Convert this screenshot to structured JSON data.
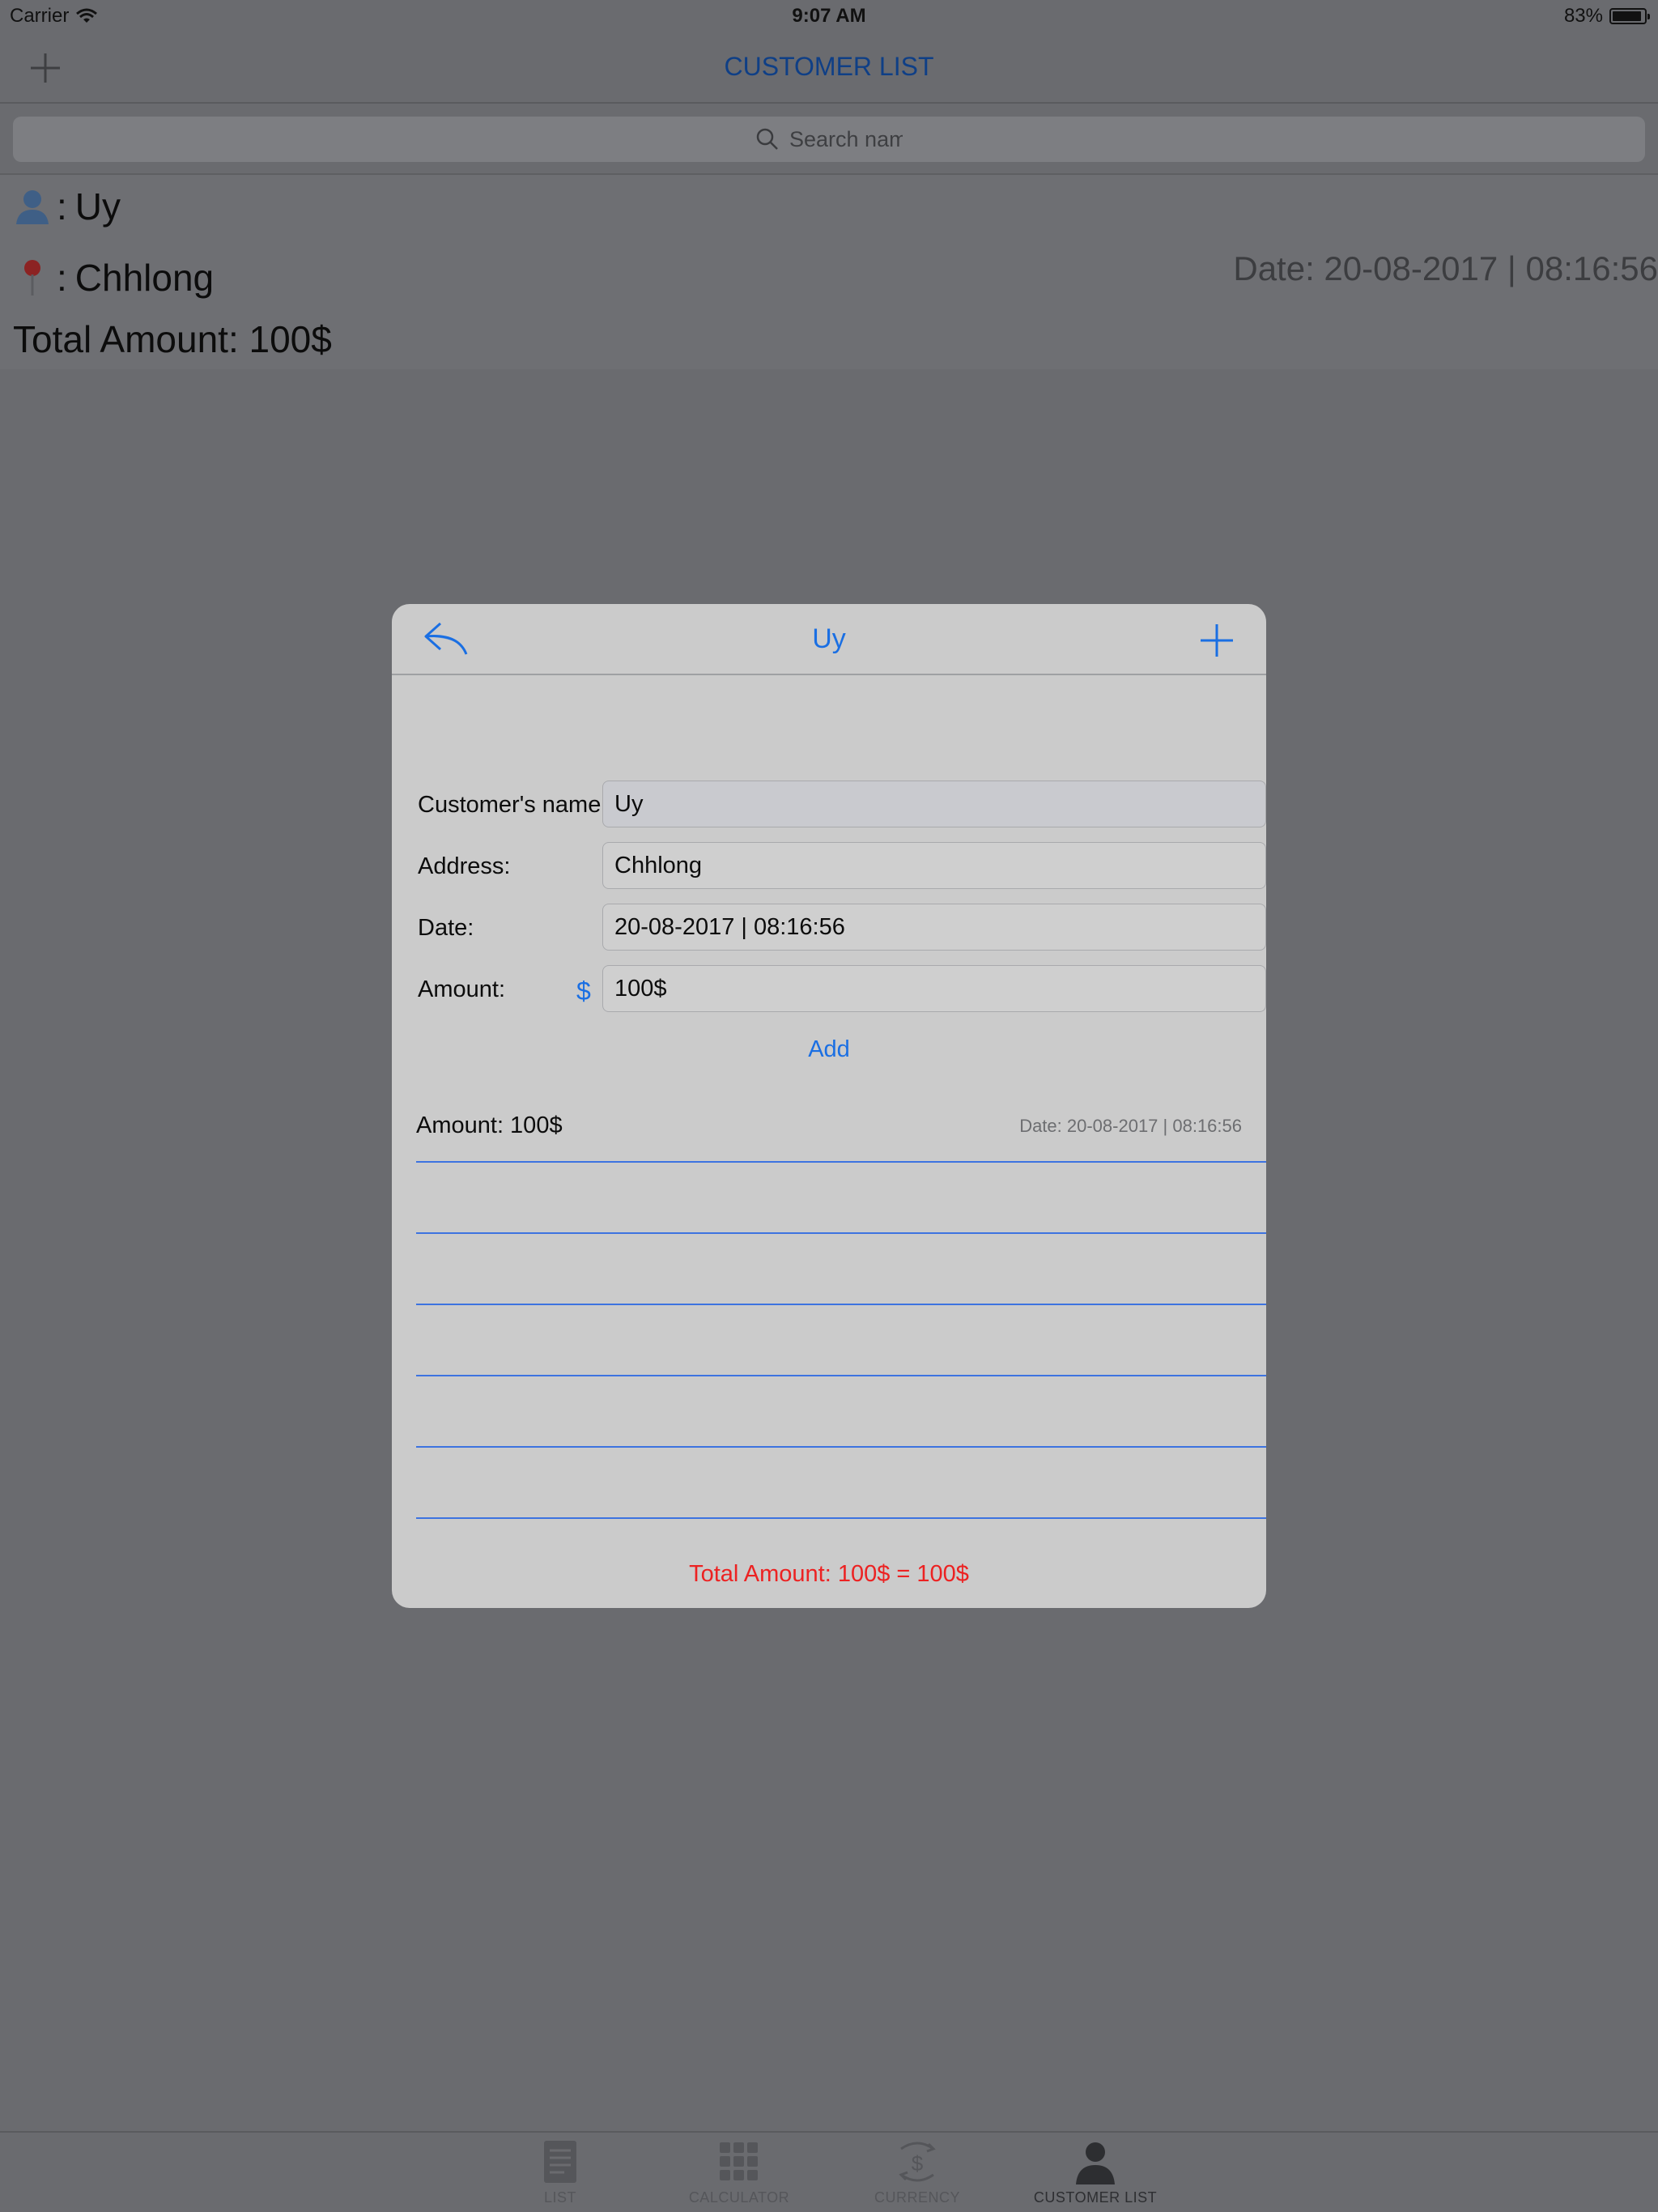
{
  "status_bar": {
    "carrier": "Carrier",
    "time": "9:07 AM",
    "battery_percent": "83%",
    "battery_level": 0.83
  },
  "nav": {
    "title": "CUSTOMER LIST",
    "title_color": "#0f3f86"
  },
  "search": {
    "placeholder": "Search name!"
  },
  "customer": {
    "name": "Uy",
    "address": "Chhlong",
    "name_prefix": ":",
    "address_prefix": ":",
    "date": "Date: 20-08-2017 | 08:16:56",
    "total": "Total Amount: 100$"
  },
  "modal": {
    "title": "Uy",
    "labels": {
      "name": "Customer's name:",
      "address": "Address:",
      "date": "Date:",
      "amount": "Amount:"
    },
    "values": {
      "name": "Uy",
      "address": "Chhlong",
      "date": "20-08-2017 | 08:16:56",
      "amount": "100$"
    },
    "currency_sign": "$",
    "add_label": "Add",
    "entries": [
      {
        "amount": "Amount: 100$",
        "date": "Date: 20-08-2017 | 08:16:56"
      }
    ],
    "total": "Total Amount: 100$ = 100$",
    "accent_color": "#1a6fe3",
    "total_color": "#ec2222"
  },
  "tabs": [
    {
      "label": "LIST",
      "icon": "list-icon"
    },
    {
      "label": "CALCULATOR",
      "icon": "calculator-icon"
    },
    {
      "label": "CURRENCY",
      "icon": "currency-icon"
    },
    {
      "label": "CUSTOMER LIST",
      "icon": "customer-icon"
    }
  ]
}
